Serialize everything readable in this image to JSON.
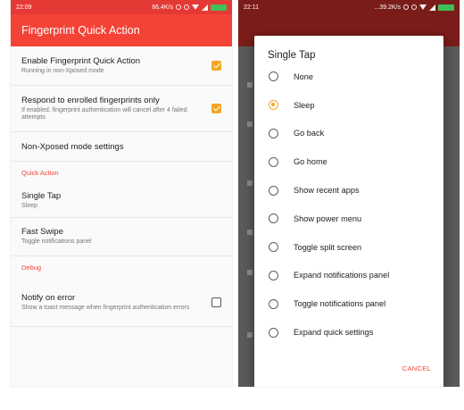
{
  "left_screen": {
    "status": {
      "time": "22:09",
      "net_speed": "66.4K/s"
    },
    "app_title": "Fingerprint Quick Action",
    "prefs": [
      {
        "title": "Enable Fingerprint Quick Action",
        "summary": "Running in non-Xposed mode",
        "checkbox": "checked"
      },
      {
        "title": "Respond to enrolled fingerprints only",
        "summary": "If enabled, fingerprint authentication will cancel after 4 failed attempts",
        "checkbox": "checked"
      },
      {
        "title": "Non-Xposed mode settings",
        "summary": ""
      }
    ],
    "category_quick_action": "Quick Action",
    "single_tap": {
      "title": "Single Tap",
      "summary": "Sleep"
    },
    "fast_swipe": {
      "title": "Fast Swipe",
      "summary": "Toggle notifications panel"
    },
    "category_debug": "Debug",
    "notify": {
      "title": "Notify on error",
      "summary": "Show a toast message when fingerprint authentication errors",
      "checkbox": "unchecked"
    }
  },
  "right_screen": {
    "status": {
      "time": "22:11",
      "net_speed": "...39.2K/s"
    },
    "dialog": {
      "title": "Single Tap",
      "selected_index": 1,
      "options": [
        "None",
        "Sleep",
        "Go back",
        "Go home",
        "Show recent apps",
        "Show power menu",
        "Toggle split screen",
        "Expand notifications panel",
        "Toggle notifications panel",
        "Expand quick settings"
      ],
      "cancel_label": "CANCEL"
    }
  },
  "colors": {
    "accent": "#f44336",
    "checkbox": "#f4a623",
    "dim_background": "#5a5a5a"
  }
}
